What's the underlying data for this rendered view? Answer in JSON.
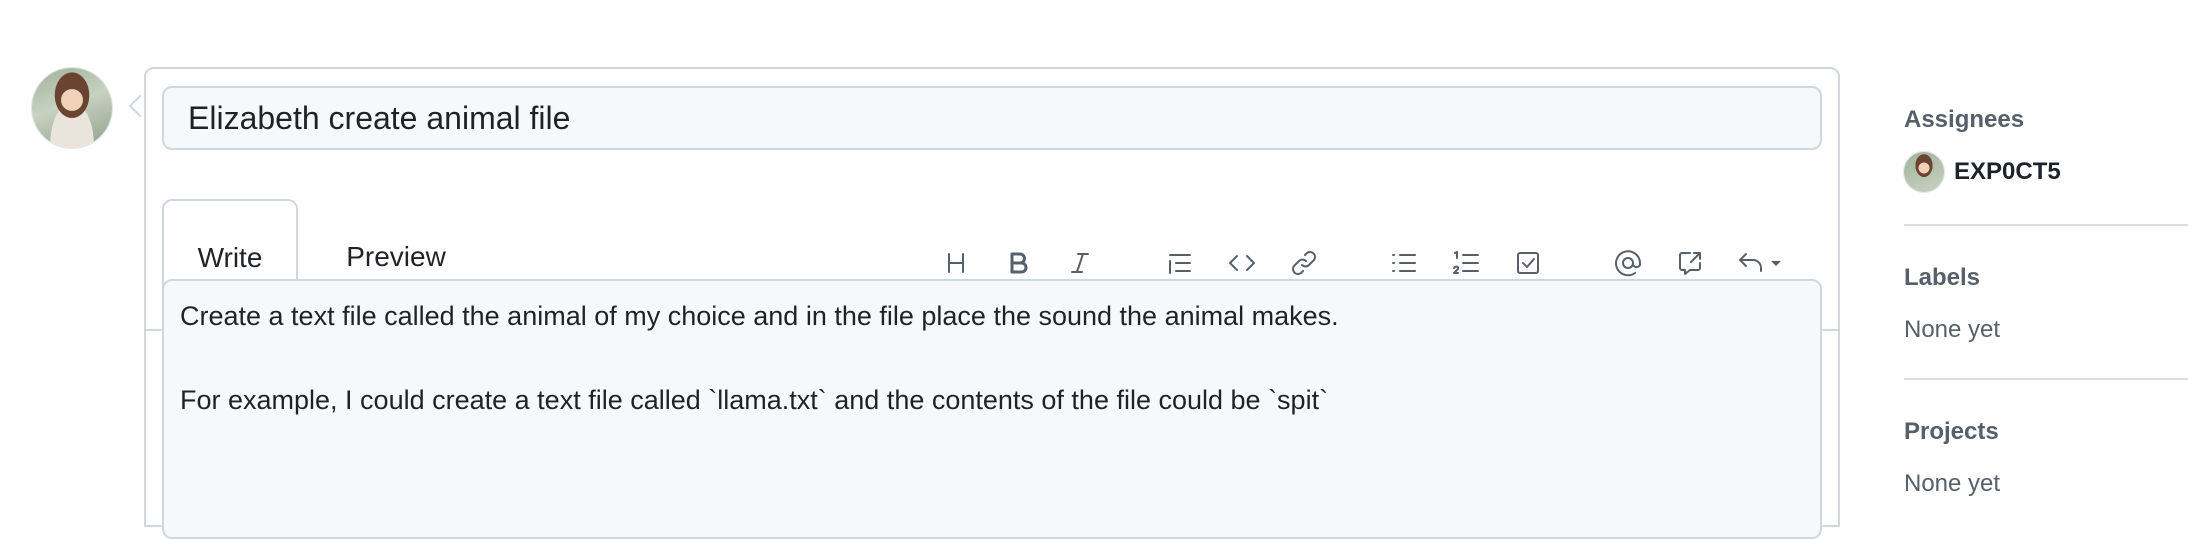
{
  "issue": {
    "title_value": "Elizabeth create animal file",
    "tabs": [
      {
        "label": "Write",
        "active": true
      },
      {
        "label": "Preview",
        "active": false
      }
    ],
    "toolbar": [
      {
        "icon": "heading-icon"
      },
      {
        "icon": "bold-icon"
      },
      {
        "icon": "italic-icon"
      },
      {
        "icon": "quote-icon"
      },
      {
        "icon": "code-icon"
      },
      {
        "icon": "link-icon"
      },
      {
        "icon": "unordered-list-icon"
      },
      {
        "icon": "ordered-list-icon"
      },
      {
        "icon": "task-list-icon"
      },
      {
        "icon": "mention-icon"
      },
      {
        "icon": "cross-reference-icon"
      },
      {
        "icon": "saved-replies-icon"
      }
    ],
    "body_lines": [
      "Create a text file called the animal of my choice and in the file place the sound the animal makes.",
      "",
      "For example, I could create a text file called `llama.txt` and the contents of the file could be `spit`"
    ]
  },
  "sidebar": {
    "assignees": {
      "heading": "Assignees",
      "user": "EXP0CT5"
    },
    "labels": {
      "heading": "Labels",
      "value": "None yet"
    },
    "projects": {
      "heading": "Projects",
      "value": "None yet"
    }
  },
  "colors": {
    "border": "#d0d7de",
    "muted_text": "#57606a",
    "field_bg": "#f6f8fa",
    "text": "#1f2328"
  }
}
